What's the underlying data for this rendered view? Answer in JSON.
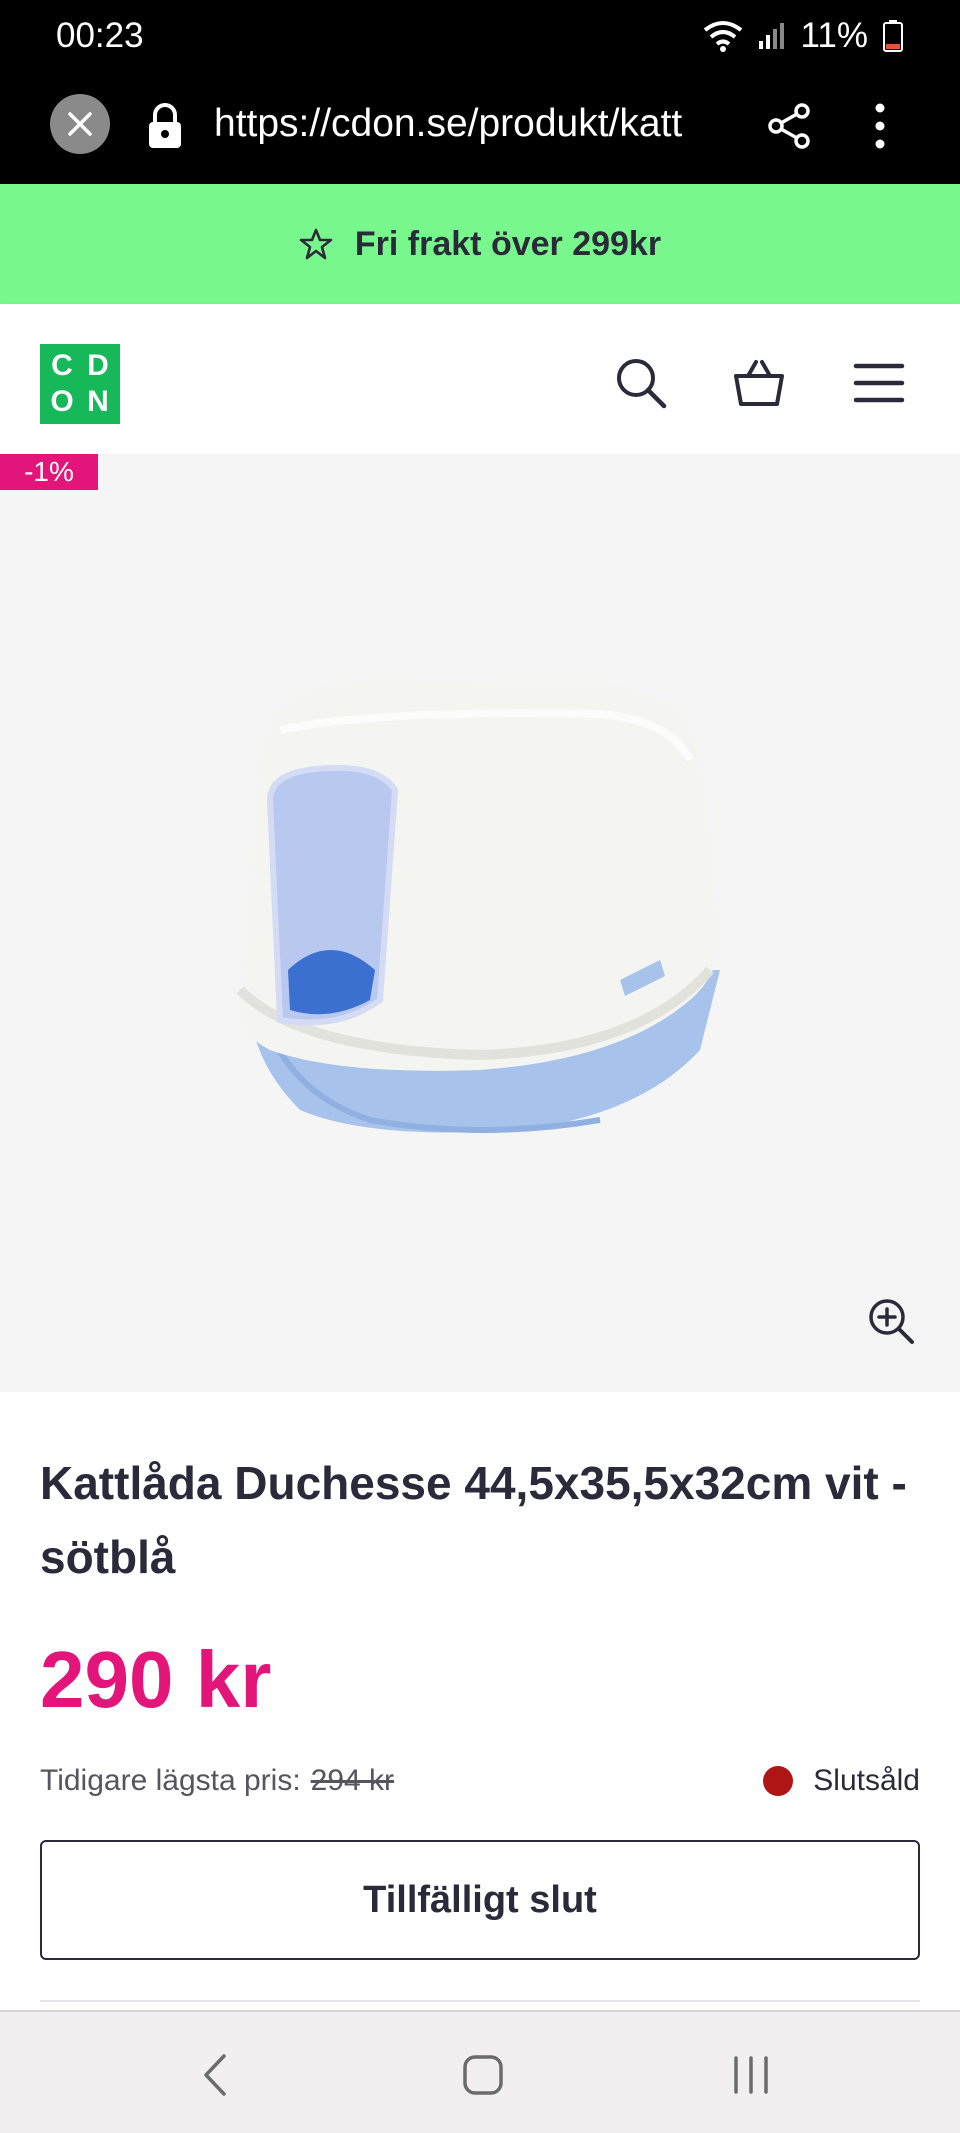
{
  "status_bar": {
    "time": "00:23",
    "battery": "11%",
    "icons": [
      "wifi-icon",
      "signal-icon",
      "battery-icon"
    ],
    "battery_color": "#e8503a"
  },
  "browser": {
    "url": "https://cdon.se/produkt/katt",
    "icons": [
      "close-icon",
      "lock-icon",
      "share-icon",
      "more-icon"
    ]
  },
  "promo": {
    "text": "Fri frakt över 299kr",
    "icon": "star-icon",
    "background": "#78f78c"
  },
  "header": {
    "logo_letters": [
      "C",
      "D",
      "O",
      "N"
    ],
    "logo_color": "#16b85a",
    "icons": [
      "search-icon",
      "basket-icon",
      "menu-icon"
    ]
  },
  "product": {
    "discount_badge": "-1%",
    "title": "Kattlåda Duchesse 44,5x35,5x32cm vit - sötblå",
    "price": "290 kr",
    "previous_price_label": "Tidigare lägsta pris:",
    "previous_price": "294 kr",
    "stock_status": "Slutsåld",
    "stock_color": "#b01515",
    "button_label": "Tillfälligt slut",
    "accent_color": "#e4157a",
    "image_alt": "Kattlåda"
  },
  "nav_bar": {
    "icons": [
      "back-icon",
      "home-icon",
      "recent-apps-icon"
    ]
  }
}
